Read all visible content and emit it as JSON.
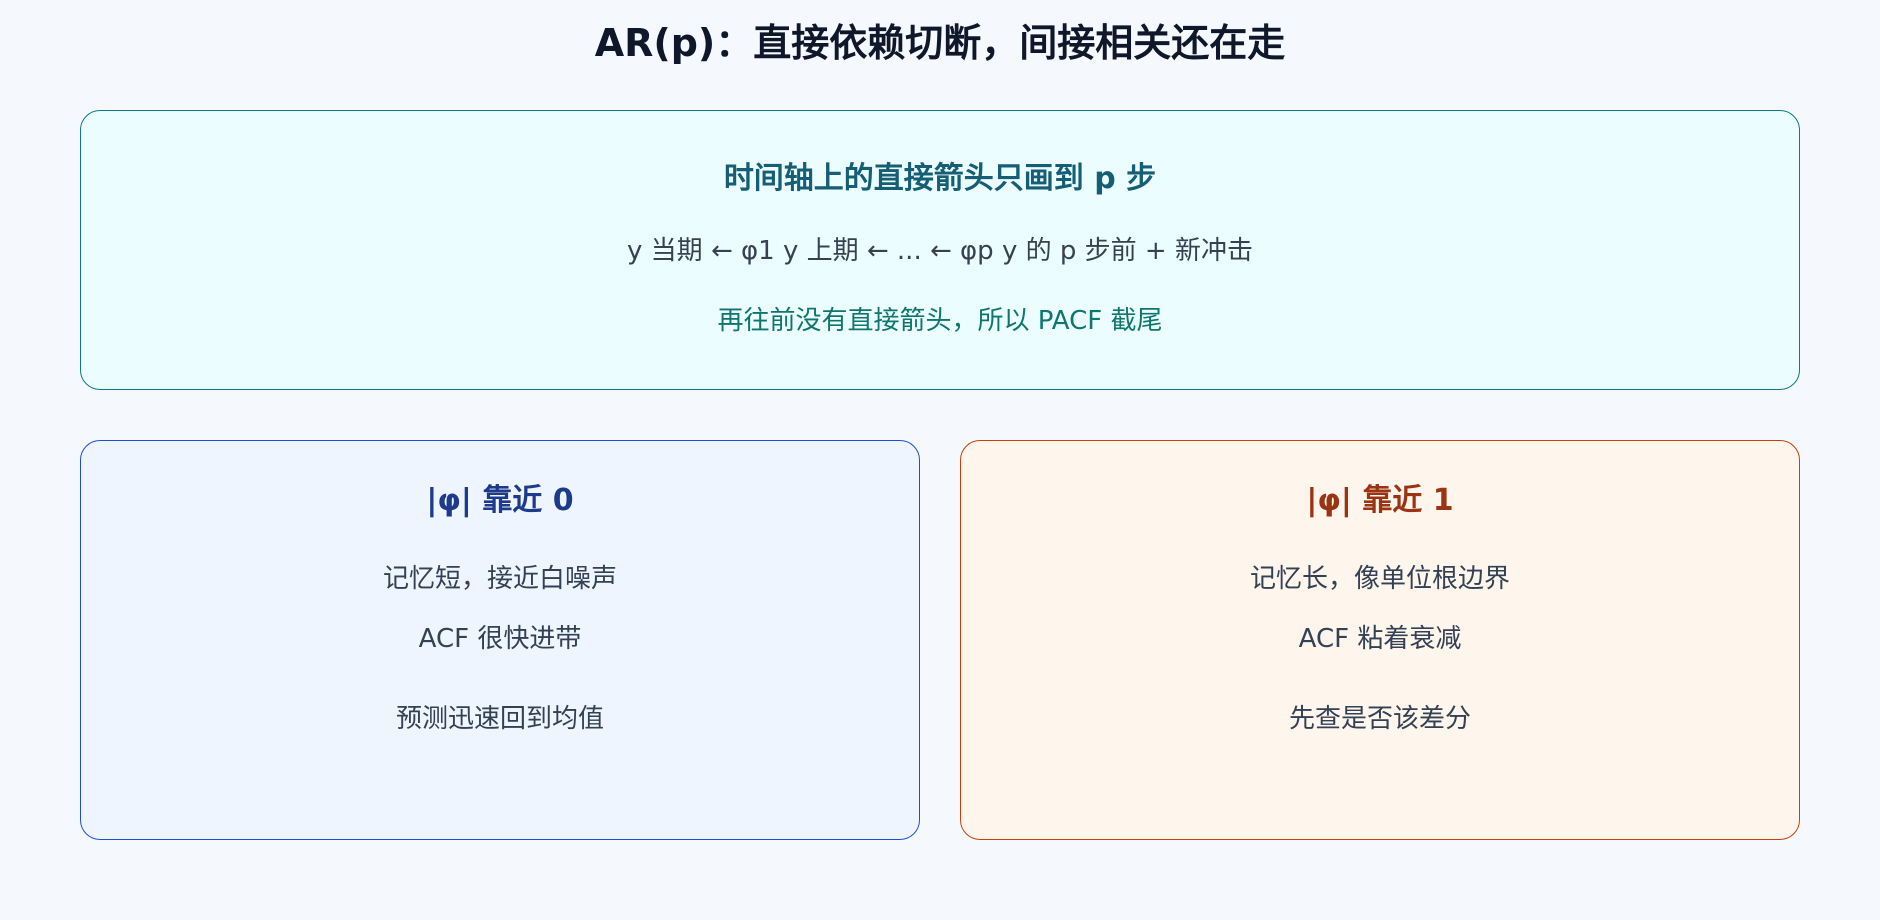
{
  "title": "AR(p)：直接依赖切断，间接相关还在走",
  "top_panel": {
    "heading": "时间轴上的直接箭头只画到 p 步",
    "formula": "y 当期 ← φ1 y 上期 ← ... ← φp y 的 p 步前 + 新冲击",
    "note": "再往前没有直接箭头，所以 PACF 截尾"
  },
  "left_panel": {
    "heading": "|φ| 靠近 0",
    "lines": [
      "记忆短，接近白噪声",
      "ACF 很快进带",
      "预测迅速回到均值"
    ]
  },
  "right_panel": {
    "heading": "|φ| 靠近 1",
    "lines": [
      "记忆长，像单位根边界",
      "ACF 粘着衰减",
      "先查是否该差分"
    ]
  },
  "colors": {
    "background": "#f5f9fd",
    "top_border": "#0e7a84",
    "top_fill": "#ebfdff",
    "left_border": "#1d4ed8",
    "left_fill": "#eef5ff",
    "right_border": "#c2410c",
    "right_fill": "#fef5ec"
  }
}
